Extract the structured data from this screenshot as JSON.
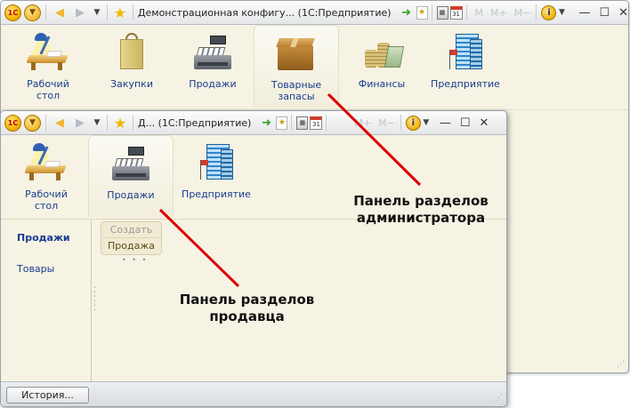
{
  "admin_window": {
    "title": "Демонстрационная конфигу...  (1С:Предприятие)",
    "memory_buttons": [
      "M",
      "M+",
      "M−"
    ],
    "sections": [
      {
        "label": "Рабочий стол",
        "icon": "desktop-icon"
      },
      {
        "label": "Закупки",
        "icon": "shopping-bag-icon"
      },
      {
        "label": "Продажи",
        "icon": "cash-register-icon"
      },
      {
        "label": "Товарные запасы",
        "icon": "cardboard-box-icon"
      },
      {
        "label": "Финансы",
        "icon": "coins-icon"
      },
      {
        "label": "Предприятие",
        "icon": "office-building-icon"
      }
    ],
    "active_section": "Товарные запасы"
  },
  "seller_window": {
    "title": "Д...  (1С:Предприятие)",
    "memory_buttons": [
      "M+",
      "M−"
    ],
    "sections": [
      {
        "label": "Рабочий стол",
        "icon": "desktop-icon"
      },
      {
        "label": "Продажи",
        "icon": "cash-register-icon"
      },
      {
        "label": "Предприятие",
        "icon": "office-building-icon"
      }
    ],
    "active_section": "Продажи",
    "navigation": [
      {
        "label": "Продажи",
        "active": true
      },
      {
        "label": "Товары",
        "active": false
      }
    ],
    "actions": {
      "create_label": "Создать",
      "sales_label": "Продажа"
    },
    "history_button": "История..."
  },
  "annotations": {
    "admin_panel_line1": "Панель разделов",
    "admin_panel_line2": "администратора",
    "seller_panel_line1": "Панель разделов",
    "seller_panel_line2": "продавца"
  },
  "colors": {
    "accent_link": "#1a3c8e",
    "pointer_line": "#dd0000",
    "panel_background": "#f6f3e4"
  }
}
